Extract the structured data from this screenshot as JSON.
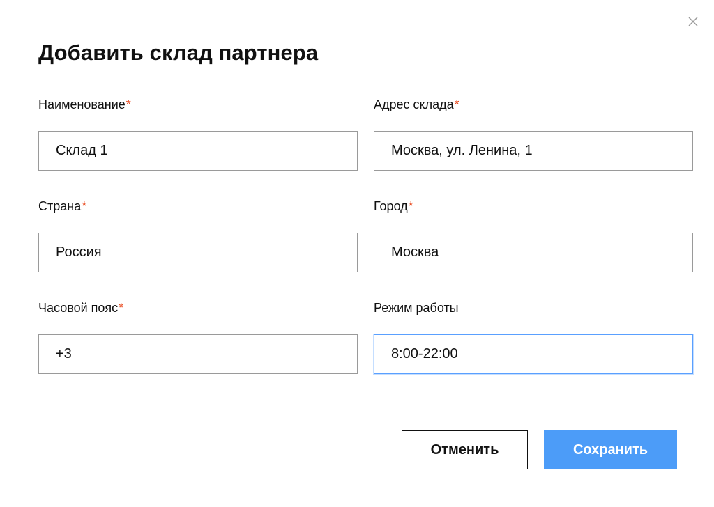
{
  "dialog": {
    "title": "Добавить склад партнера",
    "close_icon": "close-icon"
  },
  "form": {
    "name": {
      "label": "Наименование",
      "required_mark": "*",
      "value": "Склад 1"
    },
    "address": {
      "label": "Адрес склада",
      "required_mark": "*",
      "value": "Москва, ул. Ленина, 1"
    },
    "country": {
      "label": "Страна",
      "required_mark": "*",
      "value": "Россия"
    },
    "city": {
      "label": "Город",
      "required_mark": "*",
      "value": "Москва"
    },
    "timezone": {
      "label": "Часовой пояс",
      "required_mark": "*",
      "value": "+3"
    },
    "working_hours": {
      "label": "Режим работы",
      "value": "8:00-22:00"
    }
  },
  "actions": {
    "cancel_label": "Отменить",
    "save_label": "Сохранить"
  },
  "colors": {
    "required": "#e8461a",
    "primary": "#4c9cf8",
    "focus_border": "#5aa0ff"
  }
}
